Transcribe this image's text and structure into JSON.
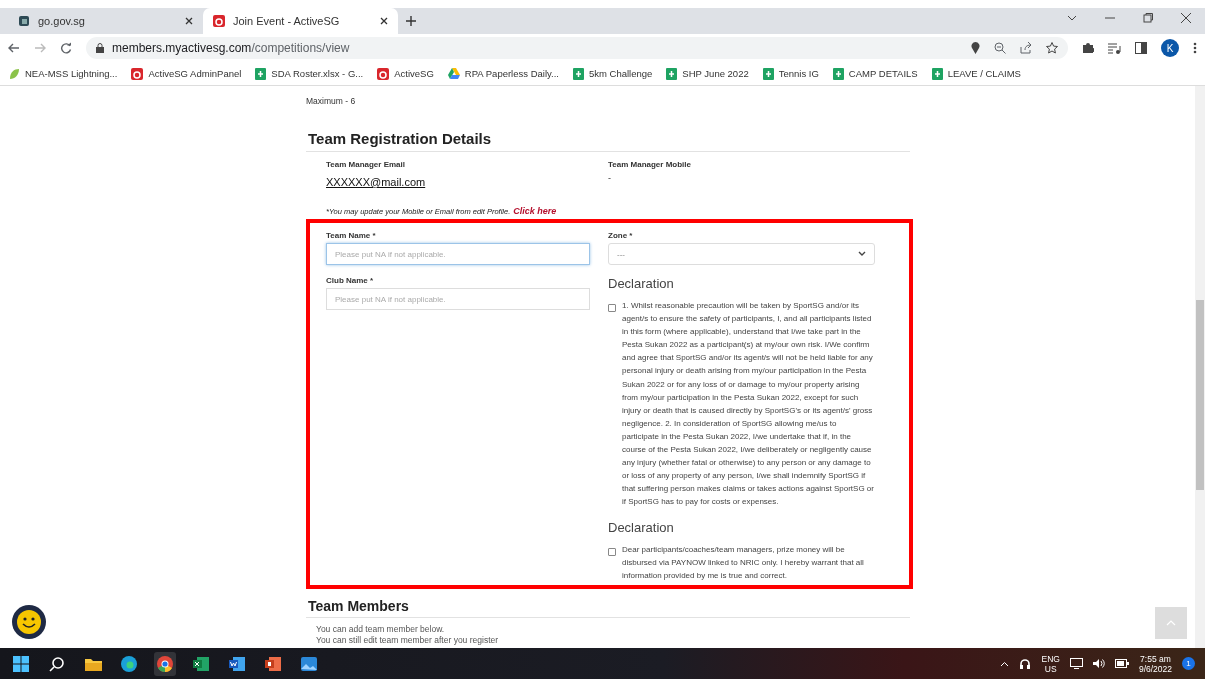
{
  "browser": {
    "tabs": [
      {
        "title": "go.gov.sg",
        "kind": "gov",
        "selected": false
      },
      {
        "title": "Join Event - ActiveSG",
        "kind": "activesg",
        "selected": true
      }
    ],
    "url": {
      "host": "members.myactivesg.com",
      "path": "/competitions/view"
    },
    "profile": "K",
    "bookmarks": [
      {
        "label": "NEA-MSS Lightning...",
        "kind": "leaf"
      },
      {
        "label": "ActiveSG AdminPanel",
        "kind": "activesg"
      },
      {
        "label": "SDA Roster.xlsx - G...",
        "kind": "sheets"
      },
      {
        "label": "ActiveSG",
        "kind": "activesg"
      },
      {
        "label": "RPA Paperless Daily...",
        "kind": "drive"
      },
      {
        "label": "5km Challenge",
        "kind": "sheets"
      },
      {
        "label": "SHP June 2022",
        "kind": "sheets"
      },
      {
        "label": "Tennis IG",
        "kind": "sheets"
      },
      {
        "label": "CAMP DETAILS",
        "kind": "sheets"
      },
      {
        "label": "LEAVE / CLAIMS",
        "kind": "sheets"
      }
    ]
  },
  "page": {
    "maximum": "Maximum - 6",
    "section_title": "Team Registration Details",
    "manager": [
      {
        "label": "Team Manager Email",
        "value": "XXXXXX@mail.com",
        "kind": "link"
      },
      {
        "label": "Team Manager Mobile",
        "value": "-",
        "kind": "plain"
      }
    ],
    "note": "*You may update your Mobile or Email from edit Profile.",
    "note_link": "Click here",
    "fields": [
      {
        "label": "Team Name *",
        "placeholder": "Please put NA if not applicable.",
        "focused": true
      },
      {
        "label": "Club Name *",
        "placeholder": "Please put NA if not applicable.",
        "focused": false
      }
    ],
    "zone": {
      "label": "Zone *",
      "placeholder": "---"
    },
    "declarations": [
      {
        "title": "Declaration",
        "checked": false,
        "text": "1. Whilst reasonable precaution will be taken by SportSG and/or its agent/s to ensure the safety of participants, I, and all participants listed in this form (where applicable), understand that I/we take part in the Pesta Sukan 2022 as a participant(s) at my/our own risk. I/We confirm and agree that SportSG and/or its agent/s will not be held liable for any personal injury or death arising from my/our participation in the Pesta Sukan 2022 or for any loss of or damage to my/our property arising from my/our participation in the Pesta Sukan 2022, except for such injury or death that is caused directly by SportSG's or its agent/s' gross negligence. 2. In consideration of SportSG allowing me/us to participate in the Pesta Sukan 2022, I/we undertake that if, in the course of the Pesta Sukan 2022, I/we deliberately or negligently cause any injury (whether fatal or otherwise) to any person or any damage to or loss of any property of any person, I/we shall indemnify SportSG if that suffering person makes claims or takes actions against SportSG or if SportSG has to pay for costs or expenses."
      },
      {
        "title": "Declaration",
        "checked": false,
        "text": "Dear participants/coaches/team managers, prize money will be disbursed via PAYNOW linked to NRIC only. I hereby warrant that all information provided by me is true and correct."
      }
    ],
    "members": {
      "title": "Team Members",
      "lines": [
        "You can add team member below.",
        "You can still edit team member after you register"
      ]
    }
  },
  "taskbar": {
    "apps": [
      {
        "kind": "start",
        "active": false
      },
      {
        "kind": "search",
        "active": false
      },
      {
        "kind": "files",
        "active": false
      },
      {
        "kind": "edge",
        "active": false
      },
      {
        "kind": "chrome",
        "active": true
      },
      {
        "kind": "excel",
        "active": false
      },
      {
        "kind": "word",
        "active": false
      },
      {
        "kind": "powerpoint",
        "active": false
      },
      {
        "kind": "photos",
        "active": false
      }
    ],
    "lang": "ENG",
    "region": "US",
    "time": "7:55 am",
    "date": "9/6/2022",
    "notifications": "1"
  }
}
